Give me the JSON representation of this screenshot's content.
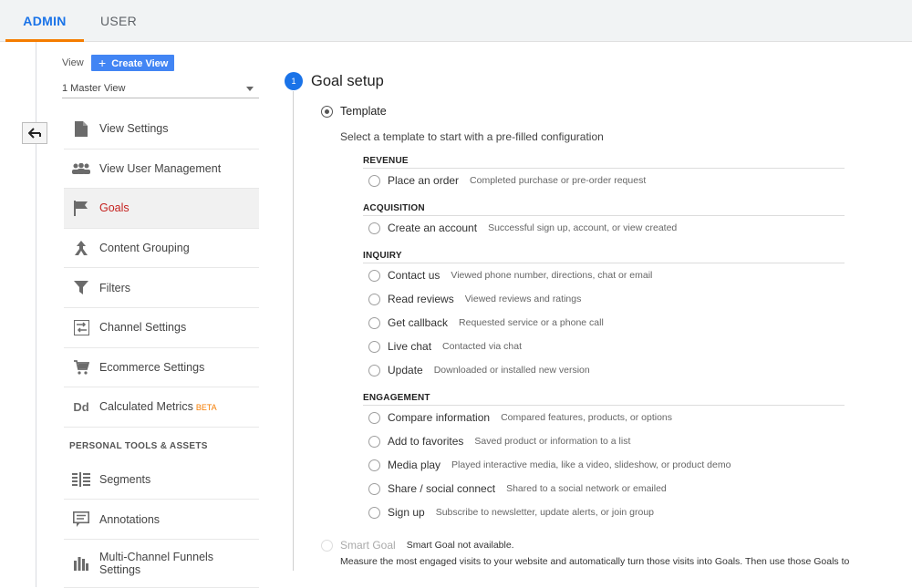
{
  "tabs": {
    "admin": "ADMIN",
    "user": "USER"
  },
  "view": {
    "label": "View",
    "create_button": "Create View",
    "selected": "1 Master View"
  },
  "nav": {
    "items": [
      {
        "label": "View Settings",
        "icon": "document-icon"
      },
      {
        "label": "View User Management",
        "icon": "people-icon"
      },
      {
        "label": "Goals",
        "icon": "flag-icon",
        "active": true
      },
      {
        "label": "Content Grouping",
        "icon": "content-grouping-icon"
      },
      {
        "label": "Filters",
        "icon": "filter-icon"
      },
      {
        "label": "Channel Settings",
        "icon": "channel-settings-icon"
      },
      {
        "label": "Ecommerce Settings",
        "icon": "cart-icon"
      },
      {
        "label": "Calculated Metrics",
        "badge": "BETA",
        "icon": "dd-icon",
        "icon_text": "Dd"
      }
    ],
    "section_heading": "PERSONAL TOOLS & ASSETS",
    "tools": [
      {
        "label": "Segments",
        "icon": "segments-icon"
      },
      {
        "label": "Annotations",
        "icon": "annotation-icon"
      },
      {
        "label": "Multi-Channel Funnels Settings",
        "line1": "Multi-Channel Funnels",
        "line2": "Settings",
        "icon": "bar-chart-icon"
      }
    ]
  },
  "step": {
    "number": "1",
    "title": "Goal setup",
    "template_label": "Template",
    "template_desc": "Select a template to start with a pre-filled configuration",
    "groups": [
      {
        "heading": "REVENUE",
        "options": [
          {
            "name": "Place an order",
            "desc": "Completed purchase or pre-order request"
          }
        ]
      },
      {
        "heading": "ACQUISITION",
        "options": [
          {
            "name": "Create an account",
            "desc": "Successful sign up, account, or view created"
          }
        ]
      },
      {
        "heading": "INQUIRY",
        "options": [
          {
            "name": "Contact us",
            "desc": "Viewed phone number, directions, chat or email"
          },
          {
            "name": "Read reviews",
            "desc": "Viewed reviews and ratings"
          },
          {
            "name": "Get callback",
            "desc": "Requested service or a phone call"
          },
          {
            "name": "Live chat",
            "desc": "Contacted via chat"
          },
          {
            "name": "Update",
            "desc": "Downloaded or installed new version"
          }
        ]
      },
      {
        "heading": "ENGAGEMENT",
        "options": [
          {
            "name": "Compare information",
            "desc": "Compared features, products, or options"
          },
          {
            "name": "Add to favorites",
            "desc": "Saved product or information to a list"
          },
          {
            "name": "Media play",
            "desc": "Played interactive media, like a video, slideshow, or product demo"
          },
          {
            "name": "Share / social connect",
            "desc": "Shared to a social network or emailed"
          },
          {
            "name": "Sign up",
            "desc": "Subscribe to newsletter, update alerts, or join group"
          }
        ]
      }
    ],
    "smart_goal_label": "Smart Goal",
    "smart_goal_note": "Smart Goal not available.",
    "smart_goal_desc": "Measure the most engaged visits to your website and automatically turn those visits into Goals. Then use those Goals to"
  }
}
